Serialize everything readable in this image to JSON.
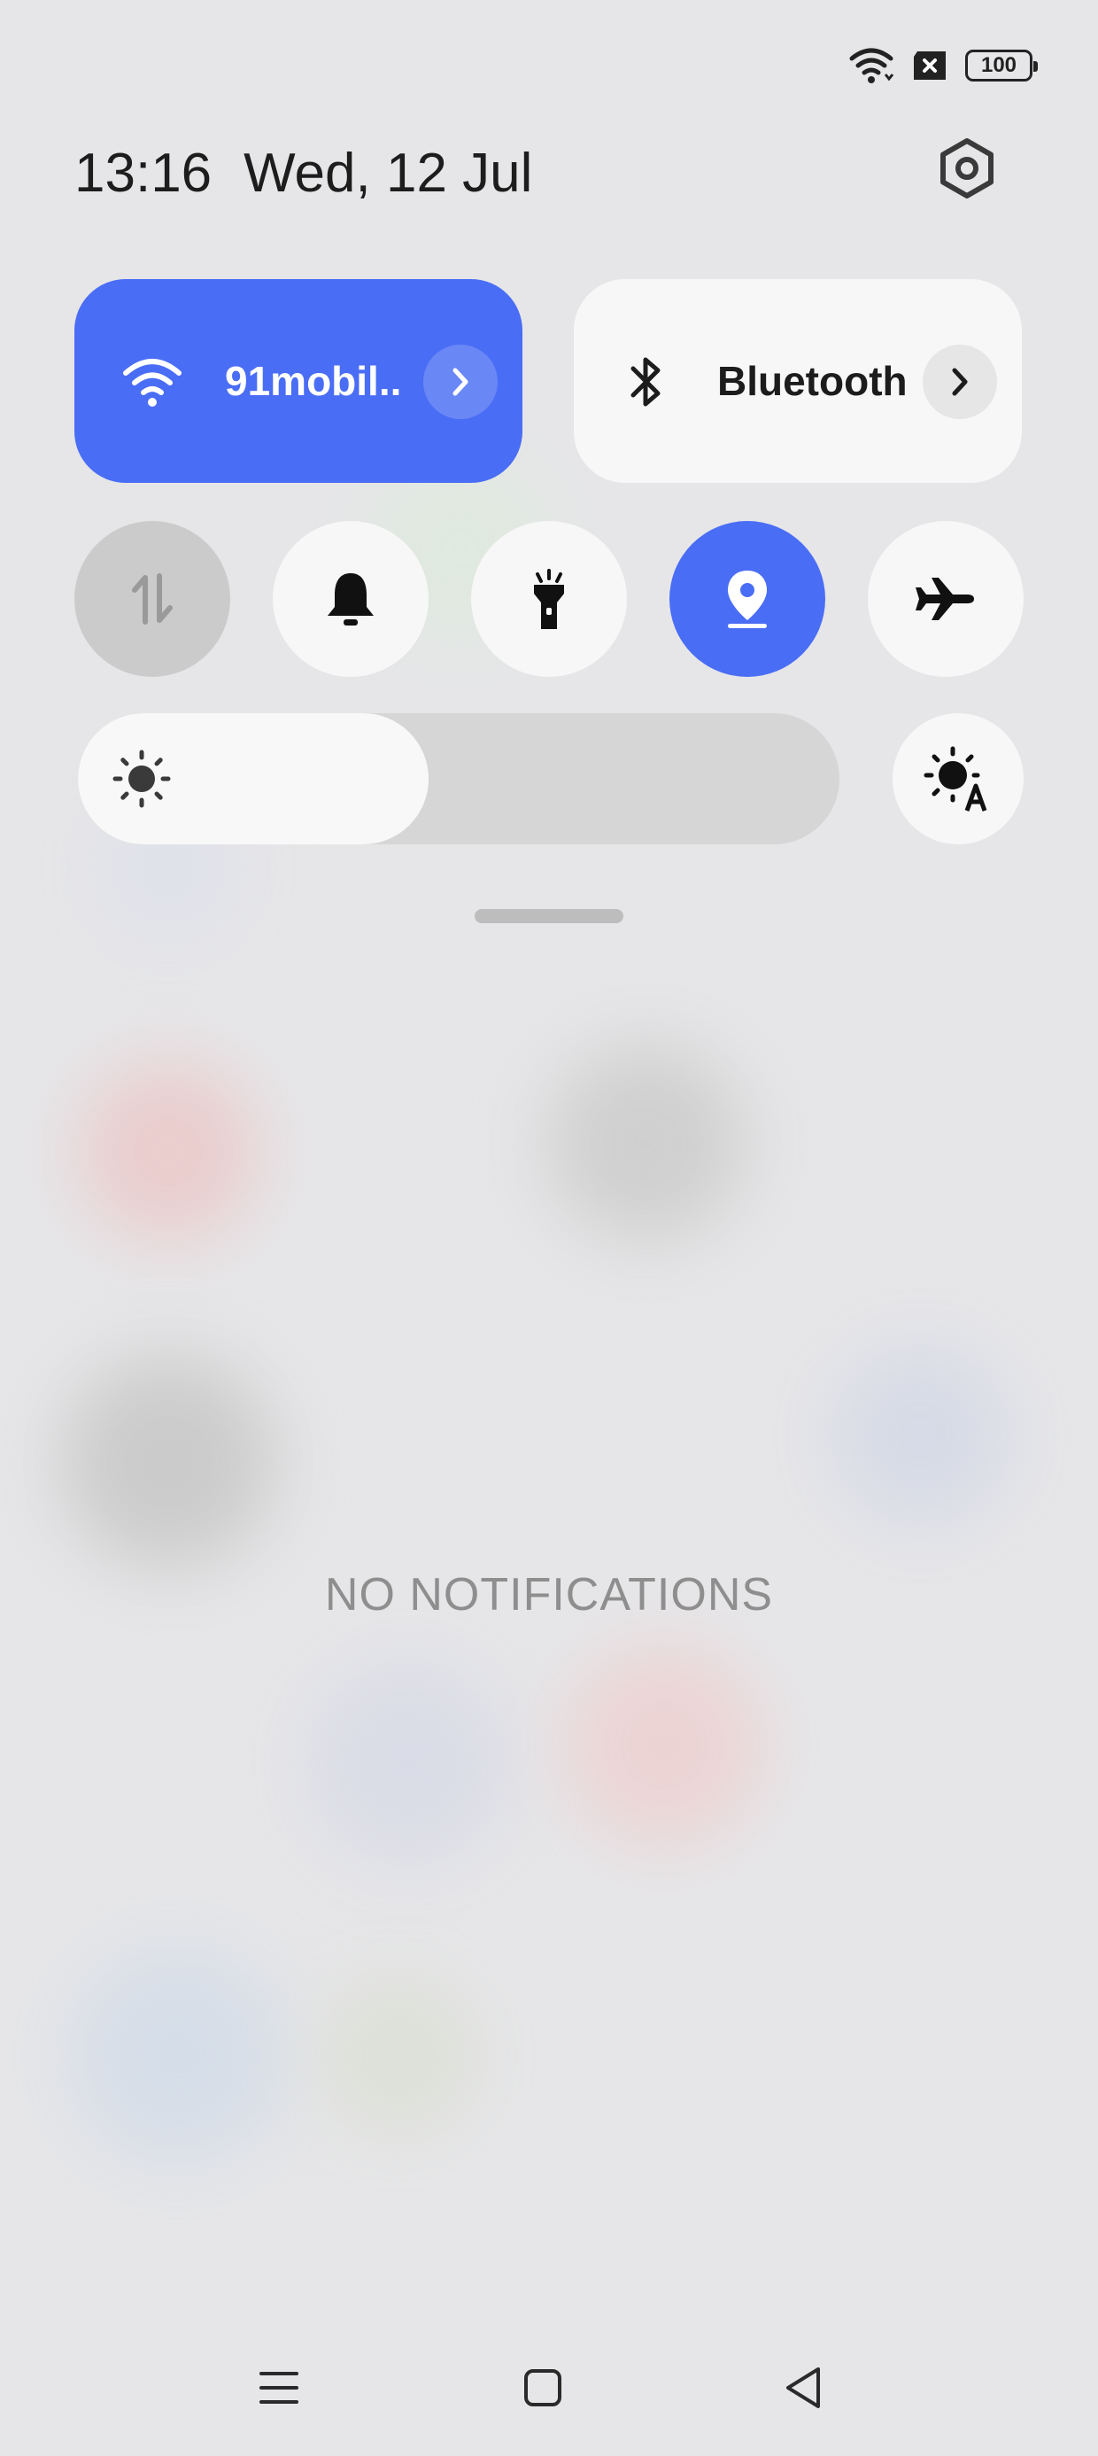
{
  "status_bar": {
    "battery_level": "100",
    "icons": [
      "wifi-icon",
      "no-sim-icon",
      "battery-icon"
    ]
  },
  "header": {
    "time": "13:16",
    "date": "Wed, 12 Jul",
    "settings_icon": "gear-icon"
  },
  "tiles": {
    "wifi": {
      "label": "91mobil..",
      "icon": "wifi-icon",
      "active": true
    },
    "bluetooth": {
      "label": "Bluetooth",
      "icon": "bluetooth-icon",
      "active": false
    }
  },
  "toggles": [
    {
      "name": "mobile-data",
      "icon": "mobile-data-icon",
      "state": "disabled"
    },
    {
      "name": "sound",
      "icon": "bell-icon",
      "state": "off"
    },
    {
      "name": "flashlight",
      "icon": "flashlight-icon",
      "state": "off"
    },
    {
      "name": "location",
      "icon": "location-pin-icon",
      "state": "on"
    },
    {
      "name": "airplane-mode",
      "icon": "airplane-icon",
      "state": "off"
    }
  ],
  "brightness": {
    "level": 0.46,
    "auto_icon": "auto-brightness-icon"
  },
  "notifications": {
    "empty_text": "NO NOTIFICATIONS"
  },
  "navigation": [
    "menu-icon",
    "home-icon",
    "back-icon"
  ],
  "colors": {
    "accent": "#4a6df5",
    "tile_light": "#f7f7f7",
    "background": "#e6e6e8"
  }
}
